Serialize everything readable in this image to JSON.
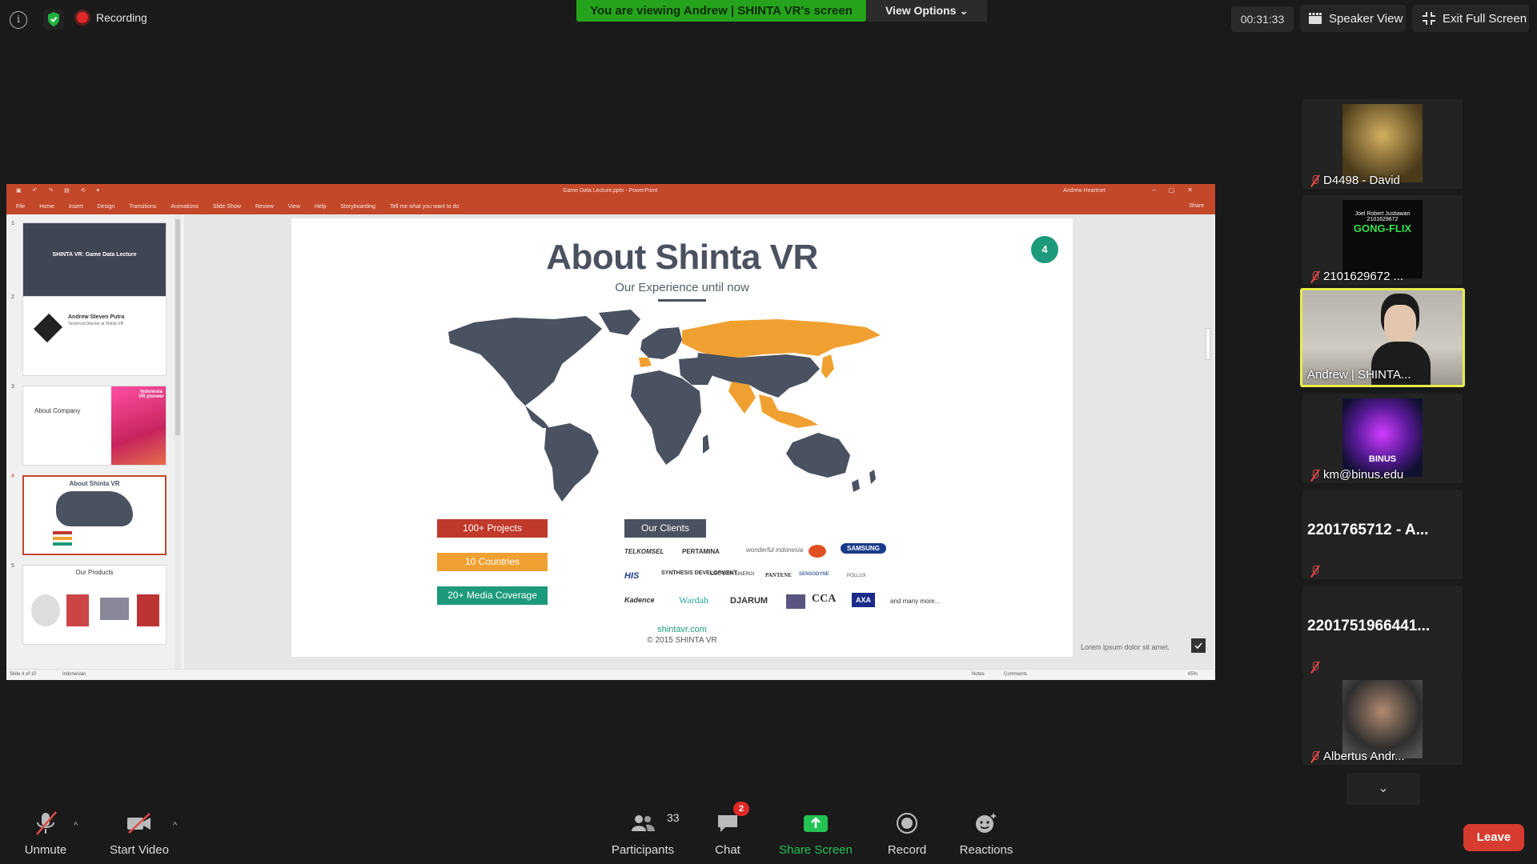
{
  "topbar": {
    "recording_label": "Recording",
    "sharing_banner": "You are viewing Andrew | SHINTA VR's screen",
    "view_options": "View Options",
    "timer": "00:31:33",
    "speaker_view": "Speaker View",
    "exit_fullscreen": "Exit Full Screen"
  },
  "ppt": {
    "document_title": "Game Data Lecture.pptx - PowerPoint",
    "user": "Andrew Heartnet",
    "share": "Share",
    "menu": [
      "File",
      "Home",
      "Insert",
      "Design",
      "Transitions",
      "Animations",
      "Slide Show",
      "Review",
      "View",
      "Help",
      "Storyboarding",
      "Tell me what you want to do"
    ],
    "status_slide": "Slide 4 of 10",
    "status_lang": "Indonesian",
    "status_notes": "Notes",
    "status_comments": "Comments",
    "zoom": "65%",
    "thumbnails": [
      {
        "num": "1",
        "title": "SHINTA VR: Game Data Lecture"
      },
      {
        "num": "2",
        "title": "Andrew Steven Putra",
        "subtitle": "Technical Director at Shinta VR"
      },
      {
        "num": "3",
        "title": "About Company",
        "tag": "Indonesia VR pioneer"
      },
      {
        "num": "4",
        "title": "About Shinta VR"
      },
      {
        "num": "5",
        "title": "Our Products"
      }
    ]
  },
  "slide": {
    "title": "About Shinta VR",
    "subtitle": "Our Experience until now",
    "page_badge": "4",
    "stats": [
      "100+ Projects",
      "10 Countries",
      "20+ Media Coverage"
    ],
    "clients_heading": "Our Clients",
    "clients_row1": [
      "TELKOMSEL",
      "PERTAMINA",
      "wonderful indonesia",
      "SAMSUNG"
    ],
    "clients_row2": [
      "HIS",
      "SYNTHESIS DEVELOPMENT",
      "DEO DIPA SINERGI",
      "PANTENE",
      "SENSODYNE",
      "POLLUX"
    ],
    "clients_row3": [
      "Kadence",
      "Wardah",
      "DJARUM",
      "CCA",
      "AXA",
      "and many more..."
    ],
    "url": "shintavr.com",
    "copyright": "© 2015 SHINTA VR",
    "footer_note": "Lorem ipsum dolor sit amet."
  },
  "participants": [
    {
      "name": "D4498 - David",
      "kind": "image",
      "muted": true
    },
    {
      "name": "2101629672 ...",
      "kind": "image",
      "muted": true,
      "image_text": [
        "Joel Robert Justiawan",
        "2101629672",
        "GONG-FLIX"
      ]
    },
    {
      "name": "Andrew | SHINTA...",
      "kind": "video",
      "muted": false,
      "active": true
    },
    {
      "name": "km@binus.edu",
      "kind": "image",
      "muted": true,
      "image_text": [
        "BINUS"
      ]
    },
    {
      "name": "2201765712 - A...",
      "kind": "text",
      "muted": true
    },
    {
      "name": "2201751966441...",
      "kind": "text",
      "muted": true
    },
    {
      "name": "Albertus Andr...",
      "kind": "image",
      "muted": true
    }
  ],
  "toolbar": {
    "unmute": "Unmute",
    "start_video": "Start Video",
    "participants": "Participants",
    "participant_count": "33",
    "chat": "Chat",
    "chat_badge": "2",
    "share_screen": "Share Screen",
    "record": "Record",
    "reactions": "Reactions",
    "leave": "Leave"
  },
  "colors": {
    "share_banner": "#26a31d",
    "ppt_accent": "#c3482a",
    "slide_teal": "#1d9a7b",
    "slide_orange": "#f0a030",
    "slide_red": "#c0392b",
    "active_speaker_border": "#e6ec4a",
    "leave": "#d63b2f"
  }
}
